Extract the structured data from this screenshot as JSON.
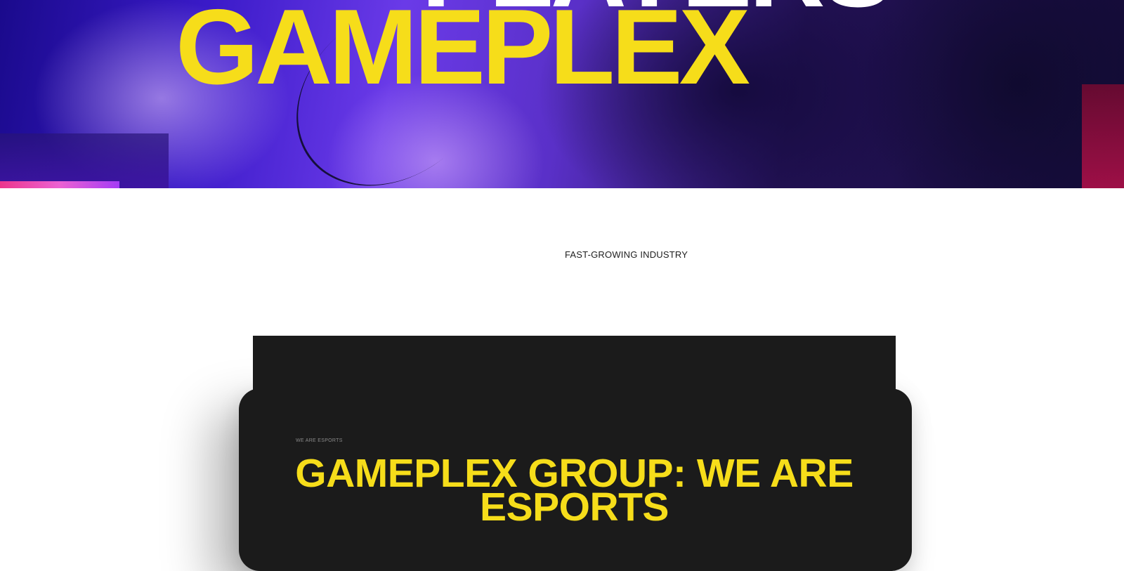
{
  "hero": {
    "top_word": "PLAYERS",
    "title": "GAMEPLEX"
  },
  "intro": {
    "eyebrow": "FAST-GROWING INDUSTRY"
  },
  "card": {
    "eyebrow": "WE ARE ESPORTS",
    "title": "GAMEPLEX GROUP: WE ARE ESPORTS"
  },
  "colors": {
    "accent": "#f6dd1a",
    "card_bg": "#1b1b1b",
    "hero_purple": "#5a30c8"
  }
}
